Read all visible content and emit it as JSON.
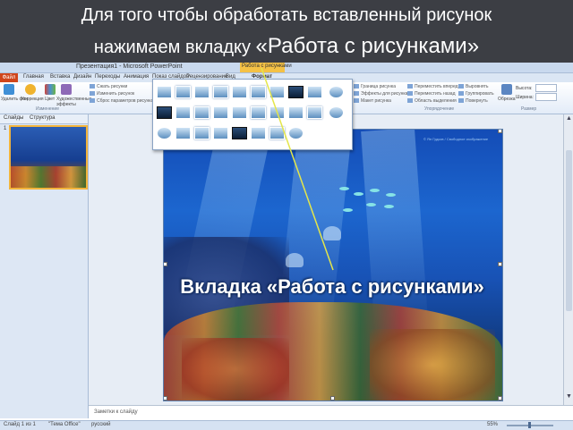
{
  "heading": {
    "line1": "Для того чтобы обработать  вставленный рисунок",
    "line2_prefix": "нажимаем вкладку ",
    "line2_emphasis": "«Работа с рисунками»"
  },
  "window": {
    "title": "Презентация1 - Microsoft PowerPoint",
    "contextual_tab_group": "Работа с рисунками",
    "file_tab": "Файл",
    "tabs": [
      "Главная",
      "Вставка",
      "Дизайн",
      "Переходы",
      "Анимация",
      "Показ слайдов",
      "Рецензирование",
      "Вид",
      "Формат"
    ]
  },
  "ribbon": {
    "buttons": [
      "Удалить фон",
      "Коррекция",
      "Цвет",
      "Художественные эффекты"
    ],
    "adjust_rows": [
      "Сжать рисунки",
      "Изменить рисунок",
      "Сброс параметров рисунка"
    ],
    "group_adjust": "Изменение",
    "right_rows": [
      "Граница рисунка",
      "Эффекты для рисунка",
      "Макет рисунка"
    ],
    "arrange_rows": [
      "Переместить вперед",
      "Переместить назад",
      "Область выделения"
    ],
    "align_rows": [
      "Выровнять",
      "Группировать",
      "Повернуть"
    ],
    "group_arrange": "Упорядочение",
    "crop_label": "Обрезка",
    "size_height": "Высота:",
    "size_width": "Ширина:",
    "group_size": "Размер"
  },
  "left_pane": {
    "tab_slides": "Слайды",
    "tab_outline": "Структура",
    "slide_number": "1"
  },
  "slide": {
    "watermark": "© Ян Гудков / Свободное изображение",
    "caption": "Вкладка «Работа с рисунками»"
  },
  "notes": {
    "placeholder": "Заметки к слайду"
  },
  "status": {
    "slide_info": "Слайд 1 из 1",
    "theme": "\"Тема Office\"",
    "language": "русский",
    "zoom": "55%"
  },
  "colors": {
    "banner_bg": "#3c3e44",
    "contextual_tab": "#f4c145",
    "file_tab": "#d0451b",
    "callout_line": "#e4e64a"
  }
}
